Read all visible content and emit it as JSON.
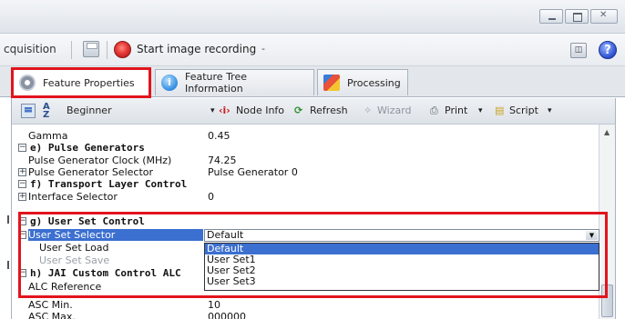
{
  "window": {
    "buttons": [
      "minimize",
      "maximize",
      "close"
    ]
  },
  "toolbar": {
    "acquisition_label": "cquisition",
    "record_label": "Start image recording",
    "record_arrow": "-",
    "help_glyph": "?"
  },
  "tabs": [
    {
      "label": "Feature Properties",
      "icon": "gear-icon",
      "active": true
    },
    {
      "label": "Feature Tree Information",
      "icon": "info-icon",
      "active": false
    },
    {
      "label": "Processing",
      "icon": "chart-icon",
      "active": false
    }
  ],
  "props_toolbar": {
    "level": "Beginner",
    "node_info": "Node Info",
    "refresh": "Refresh",
    "wizard": "Wizard",
    "print": "Print",
    "script": "Script"
  },
  "grid_rows": [
    {
      "name": "Gamma",
      "value": "0.45",
      "kind": "prop"
    },
    {
      "name": "e) Pulse Generators",
      "value": "",
      "kind": "cat"
    },
    {
      "name": "Pulse Generator Clock (MHz)",
      "value": "74.25",
      "kind": "prop"
    },
    {
      "name": "Pulse Generator Selector",
      "value": "Pulse Generator 0",
      "kind": "prop"
    },
    {
      "name": "f) Transport Layer Control",
      "value": "",
      "kind": "cat"
    },
    {
      "name": "Interface Selector",
      "value": "0",
      "kind": "prop"
    },
    {
      "name": "g) User Set Control",
      "value": "",
      "kind": "cat"
    },
    {
      "name": "User Set Selector",
      "value": "Default",
      "kind": "selected"
    },
    {
      "name": "User Set Load",
      "value": "",
      "kind": "sub"
    },
    {
      "name": "User Set Save",
      "value": "",
      "kind": "sub-greyed"
    },
    {
      "name": "h) JAI Custom Control ALC",
      "value": "",
      "kind": "cat"
    },
    {
      "name": "ALC Reference",
      "value": "",
      "kind": "prop"
    },
    {
      "name": "ASC Min.",
      "value": "10",
      "kind": "prop"
    },
    {
      "name": "ASC Max.",
      "value": "000000",
      "kind": "prop"
    }
  ],
  "dropdown": {
    "selected": "Default",
    "options": [
      "Default",
      "User Set1",
      "User Set2",
      "User Set3"
    ]
  },
  "colors": {
    "highlight_border": "#e2141c",
    "selection": "#3b6fd0"
  }
}
